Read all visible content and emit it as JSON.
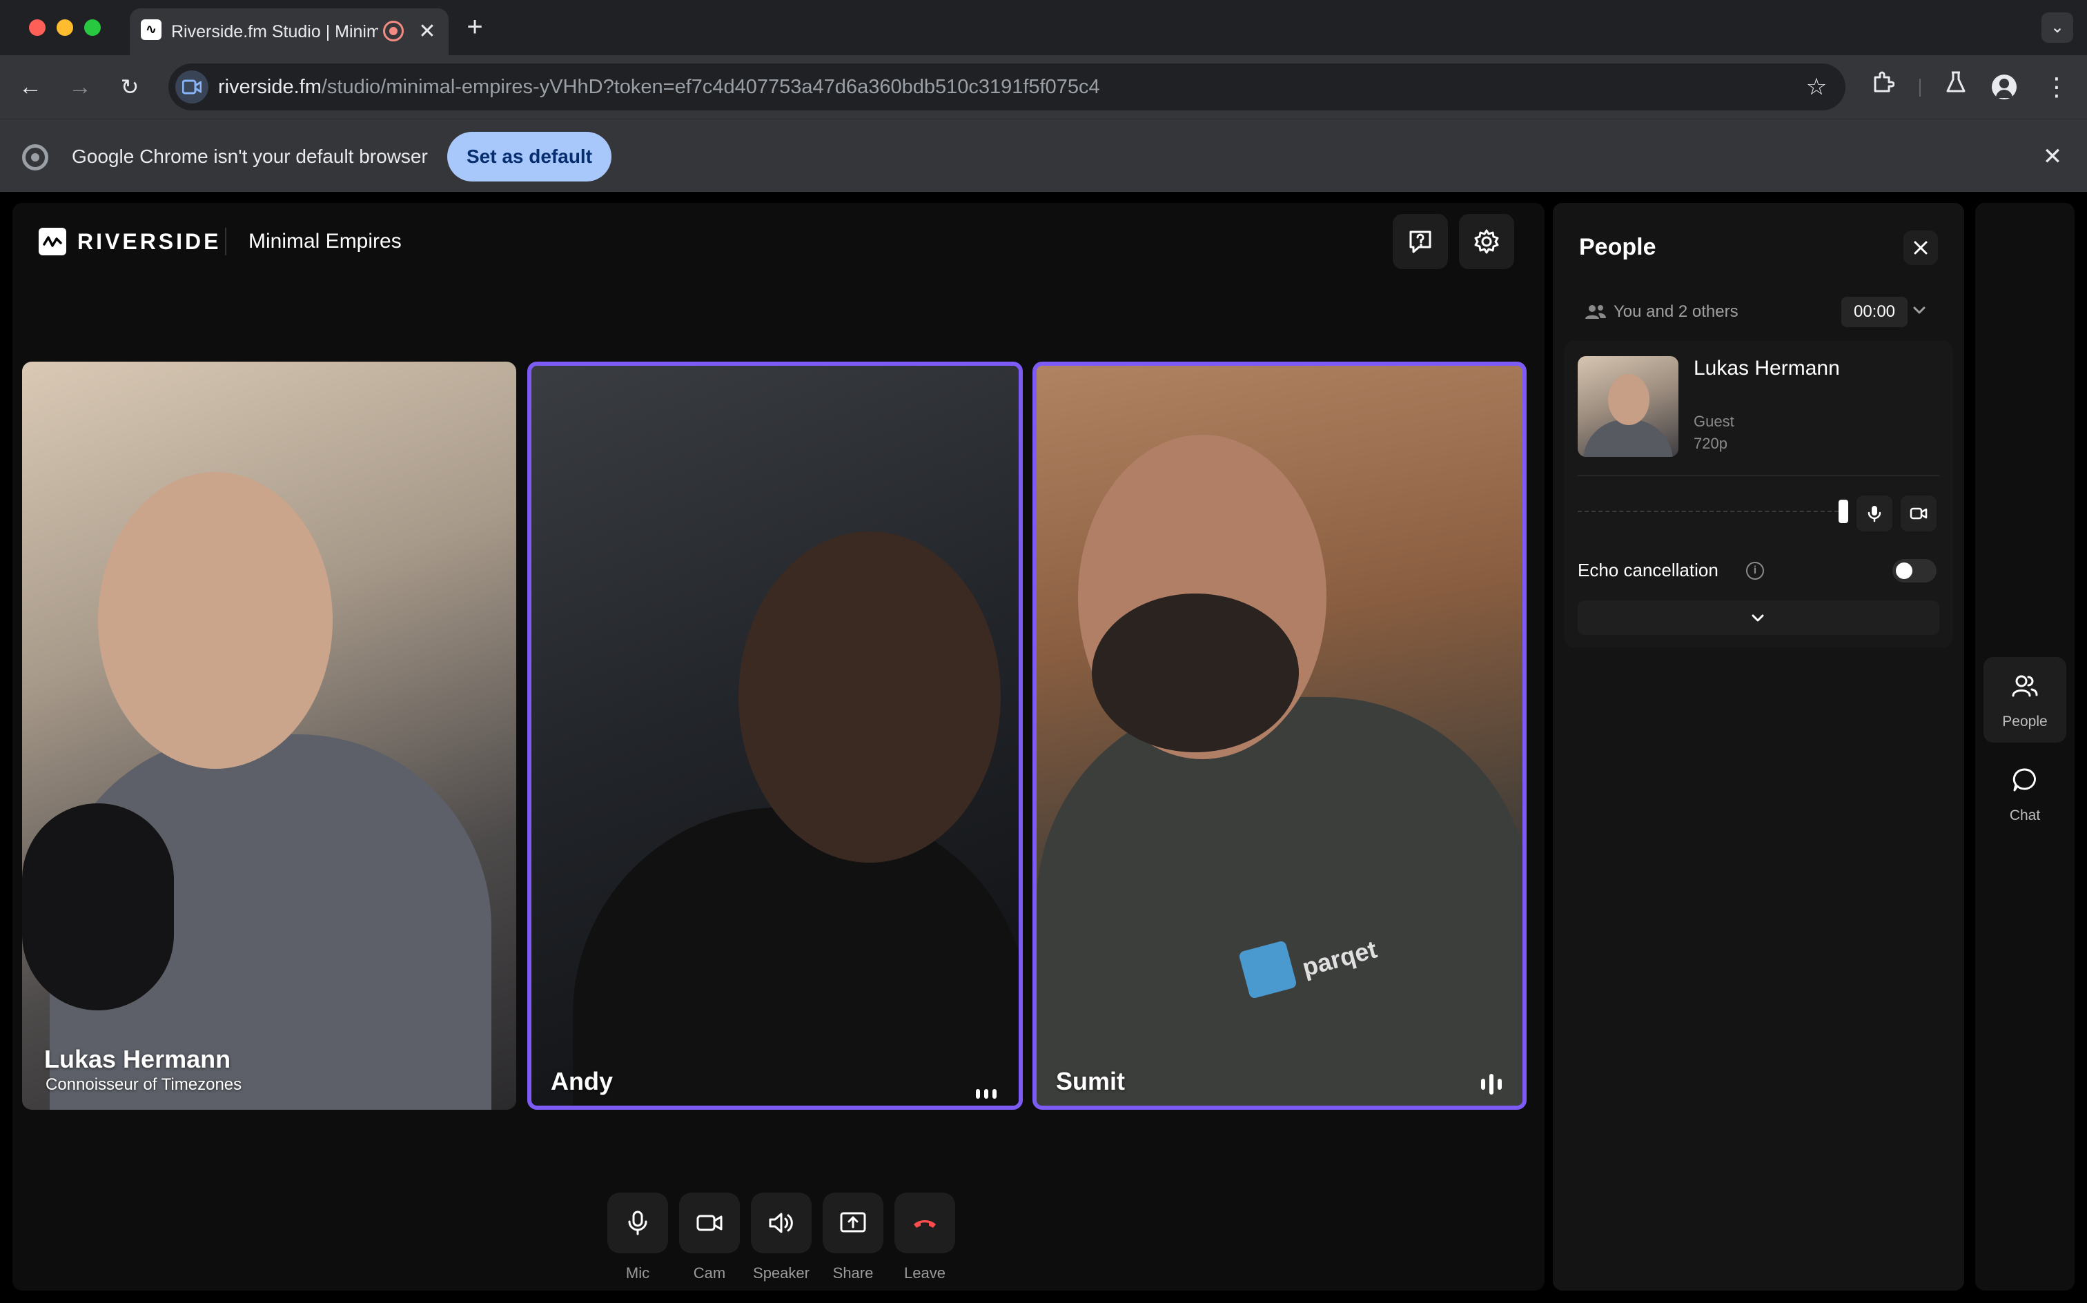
{
  "browser": {
    "tab_title": "Riverside.fm Studio | Minimal Empires",
    "tab_close": "✕",
    "new_tab": "+",
    "url_host": "riverside.fm",
    "url_path": "/studio/minimal-empires-yVHhD?token=ef7c4d407753a47d6a360bdb510c3191f5f075c4",
    "infobar_text": "Google Chrome isn't your default browser",
    "set_default_label": "Set as default"
  },
  "studio": {
    "brand": "RIVERSIDE",
    "name": "Minimal Empires"
  },
  "participants": [
    {
      "name": "Lukas Hermann",
      "subtitle": "Connoisseur of Timezones",
      "speaking": false
    },
    {
      "name": "Andy",
      "subtitle": "",
      "speaking": true
    },
    {
      "name": "Sumit",
      "subtitle": "",
      "speaking": true,
      "logo_text": "parqet"
    }
  ],
  "controls": {
    "mic": "Mic",
    "cam": "Cam",
    "speaker": "Speaker",
    "share": "Share",
    "leave": "Leave"
  },
  "people_panel": {
    "title": "People",
    "others_text": "You and 2 others",
    "timer": "00:00",
    "person": {
      "name": "Lukas Hermann",
      "role": "Guest",
      "resolution": "720p"
    },
    "echo_label": "Echo cancellation",
    "echo_enabled": false
  },
  "rail": {
    "people": "People",
    "chat": "Chat"
  },
  "colors": {
    "accent": "#7c5cf5",
    "leave": "#ff4d4d",
    "default_button": "#a8c7fa"
  }
}
